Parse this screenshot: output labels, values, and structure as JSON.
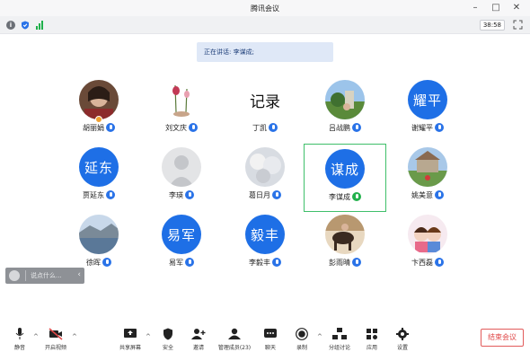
{
  "window": {
    "title": "腾讯会议",
    "minimize": "–",
    "maximize": "□",
    "close": "✕"
  },
  "status": {
    "timer": "38:58",
    "info": "i"
  },
  "speaking": {
    "text": "正在讲话: 李谋成;"
  },
  "participants": [
    {
      "name": "胡丽娟",
      "avatar": "photo",
      "host": true
    },
    {
      "name": "刘文庆",
      "avatar": "photo"
    },
    {
      "name": "丁凯",
      "avatar": "calligraphy",
      "avatar_text": "记录"
    },
    {
      "name": "吕战鹏",
      "avatar": "photo"
    },
    {
      "name": "谢耀平",
      "avatar": "text",
      "avatar_text": "耀平"
    },
    {
      "name": "贾延东",
      "avatar": "text",
      "avatar_text": "延东"
    },
    {
      "name": "李瑛",
      "avatar": "default"
    },
    {
      "name": "葛日月",
      "avatar": "photo"
    },
    {
      "name": "李谋成",
      "avatar": "text",
      "avatar_text": "谋成",
      "speaking": true
    },
    {
      "name": "姚美意",
      "avatar": "photo"
    },
    {
      "name": "徐晖",
      "avatar": "photo"
    },
    {
      "name": "易军",
      "avatar": "text",
      "avatar_text": "易军"
    },
    {
      "name": "李毅丰",
      "avatar": "text",
      "avatar_text": "毅丰"
    },
    {
      "name": "彭雨晴",
      "avatar": "photo"
    },
    {
      "name": "卞西磊",
      "avatar": "photo"
    }
  ],
  "chat": {
    "placeholder": "说点什么..."
  },
  "toolbar": {
    "mute": "静音",
    "video": "开启视频",
    "share": "共享屏幕",
    "security": "安全",
    "invite": "邀请",
    "members": "管理成员(23)",
    "chat": "聊天",
    "record": "录制",
    "breakout": "分组讨论",
    "apps": "应用",
    "settings": "设置",
    "end": "结束会议"
  },
  "colors": {
    "accent": "#1e6fe6",
    "speaking_border": "#3fbf6a",
    "end": "#e04848"
  }
}
